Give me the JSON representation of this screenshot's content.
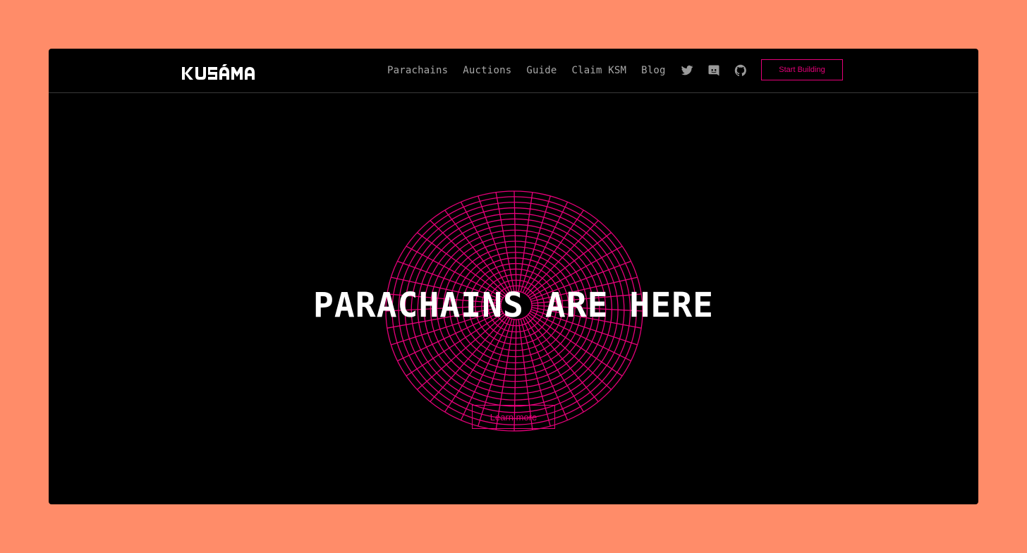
{
  "brand": {
    "logo_text": "KUSAMA",
    "accent_color": "#e6007a",
    "frame_color": "#ff8c69"
  },
  "nav": {
    "links": [
      "Parachains",
      "Auctions",
      "Guide",
      "Claim KSM",
      "Blog"
    ],
    "icons": [
      "twitter-icon",
      "discord-icon",
      "github-icon"
    ],
    "cta_label": "Start Building"
  },
  "hero": {
    "title": "PARACHAINS ARE HERE",
    "button_label": "Learn more"
  }
}
